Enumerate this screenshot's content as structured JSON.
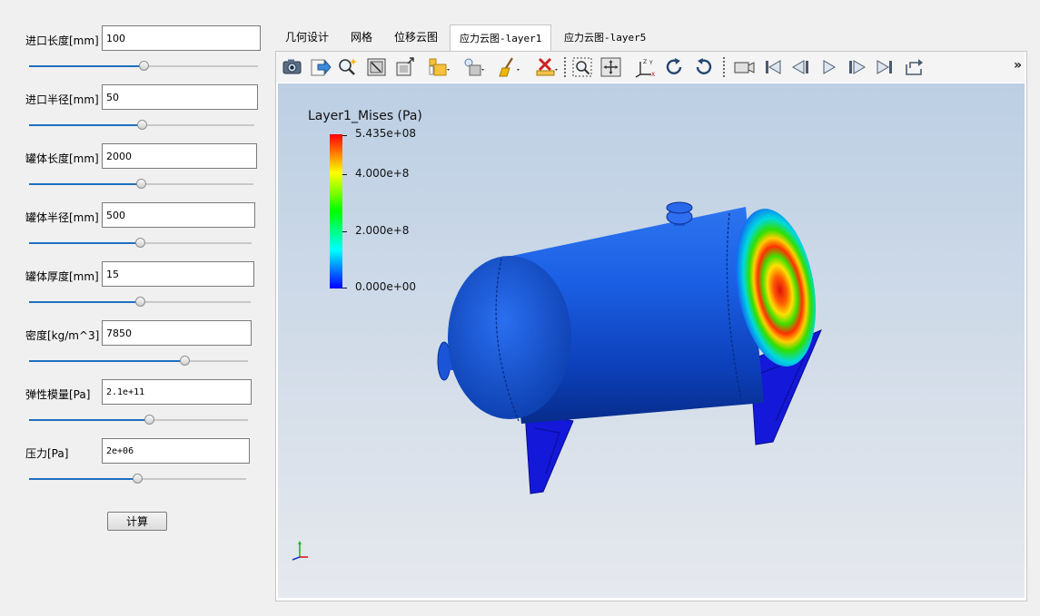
{
  "params": [
    {
      "label": "进口长度[mm]",
      "value": "100",
      "slider": 0.5
    },
    {
      "label": "进口半径[mm]",
      "value": "50",
      "slider": 0.5
    },
    {
      "label": "罐体长度[mm]",
      "value": "2000",
      "slider": 0.5
    },
    {
      "label": "罐体半径[mm]",
      "value": "500",
      "slider": 0.5
    },
    {
      "label": "罐体厚度[mm]",
      "value": "15",
      "slider": 0.5
    },
    {
      "label": "密度[kg/m^3]",
      "value": "7850",
      "slider": 0.72
    },
    {
      "label": "弹性模量[Pa]",
      "value": "2.1e+11",
      "slider": 0.55
    },
    {
      "label": "压力[Pa]",
      "value": "2e+06",
      "slider": 0.5
    }
  ],
  "calc_button": "计算",
  "tabs": [
    "几何设计",
    "网格",
    "位移云图",
    "应力云图-layer1",
    "应力云图-layer5"
  ],
  "active_tab": "应力云图-layer1",
  "toolbar_icons": [
    "camera-icon",
    "export-icon",
    "magic-select-icon",
    "reset-view-icon",
    "fit-window-icon",
    "color-map-icon",
    "lights-icon",
    "clear-icon",
    "remove-icon",
    "zoom-box-icon",
    "zoom-fit-icon",
    "axes-icon",
    "rotate-cw-icon",
    "rotate-ccw-icon",
    "video-icon",
    "first-frame-icon",
    "prev-frame-icon",
    "play-icon",
    "next-frame-icon",
    "last-frame-icon",
    "loop-icon"
  ],
  "toolbar_more": "»",
  "legend": {
    "title": "Layer1_Mises (Pa)",
    "ticks": [
      "5.435e+08",
      "4.000e+8",
      "2.000e+8",
      "0.000e+00"
    ]
  },
  "colors": {
    "accent": "#1e6fc2",
    "viewport_top": "#bccfe4",
    "viewport_bottom": "#e6e9ee",
    "colormap": [
      "#0000ff",
      "#00ffff",
      "#00ff00",
      "#ffff00",
      "#ff0000"
    ]
  }
}
